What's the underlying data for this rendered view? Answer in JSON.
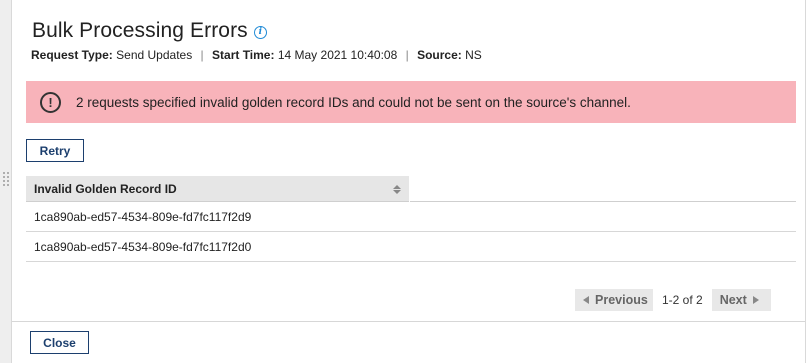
{
  "dialog": {
    "title": "Bulk Processing Errors"
  },
  "meta": {
    "request_type_label": "Request Type:",
    "request_type_value": "Send Updates",
    "start_time_label": "Start Time:",
    "start_time_value": "14 May 2021 10:40:08",
    "source_label": "Source:",
    "source_value": "NS",
    "separator": "|"
  },
  "alert": {
    "icon": "exclamation-circle-icon",
    "message": "2 requests specified invalid golden record IDs and could not be sent on the source's channel.",
    "background": "#f8b3ba"
  },
  "actions": {
    "retry_label": "Retry",
    "close_label": "Close"
  },
  "table": {
    "columns": [
      "Invalid Golden Record ID"
    ],
    "rows": [
      [
        "1ca890ab-ed57-4534-809e-fd7fc117f2d9"
      ],
      [
        "1ca890ab-ed57-4534-809e-fd7fc117f2d0"
      ]
    ]
  },
  "pagination": {
    "previous_label": "Previous",
    "count_text": "1-2 of 2",
    "next_label": "Next"
  },
  "colors": {
    "primary_button_border": "#1c3f6e",
    "info_icon": "#1f8ad6",
    "table_header_bg": "#e6e6e6"
  }
}
